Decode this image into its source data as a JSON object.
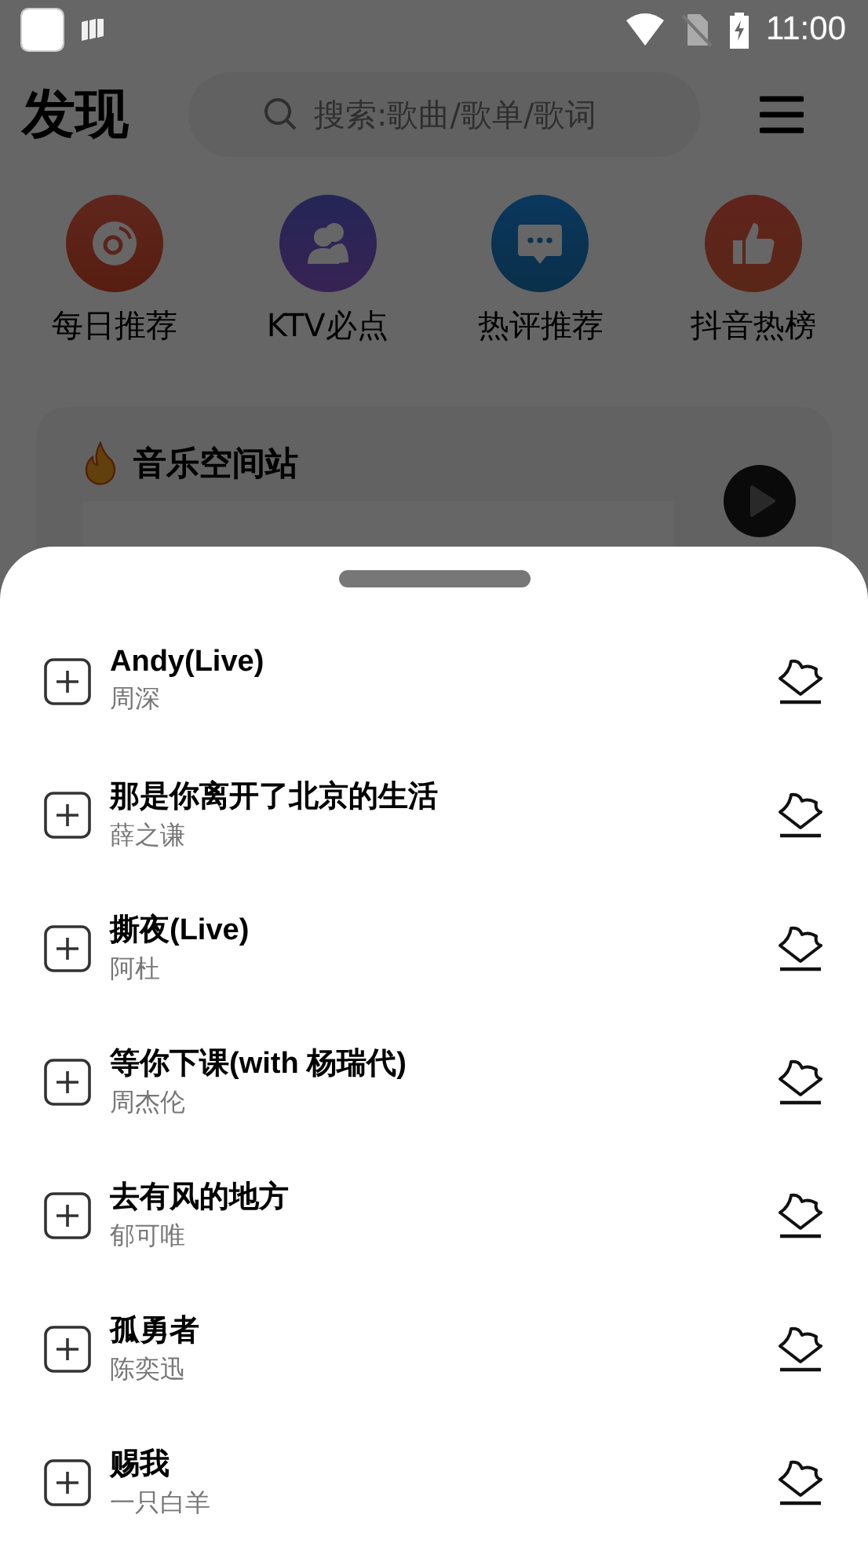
{
  "status_bar": {
    "time": "11:00"
  },
  "header": {
    "title": "发现",
    "search": {
      "placeholder": "搜索:歌曲/歌单/歌词"
    }
  },
  "shortcuts": [
    {
      "label": "每日推荐",
      "kind": "disc"
    },
    {
      "label": "KTV必点",
      "kind": "people"
    },
    {
      "label": "热评推荐",
      "kind": "comment"
    },
    {
      "label": "抖音热榜",
      "kind": "thumb"
    }
  ],
  "card": {
    "title": "音乐空间站"
  },
  "sheet": {
    "songs": [
      {
        "title": "Andy(Live)",
        "artist": "周深"
      },
      {
        "title": "那是你离开了北京的生活",
        "artist": "薛之谦"
      },
      {
        "title": "撕夜(Live)",
        "artist": "阿杜"
      },
      {
        "title": "等你下课(with 杨瑞代)",
        "artist": "周杰伦"
      },
      {
        "title": "去有风的地方",
        "artist": "郁可唯"
      },
      {
        "title": "孤勇者",
        "artist": "陈奕迅"
      },
      {
        "title": "赐我",
        "artist": "一只白羊"
      }
    ]
  }
}
